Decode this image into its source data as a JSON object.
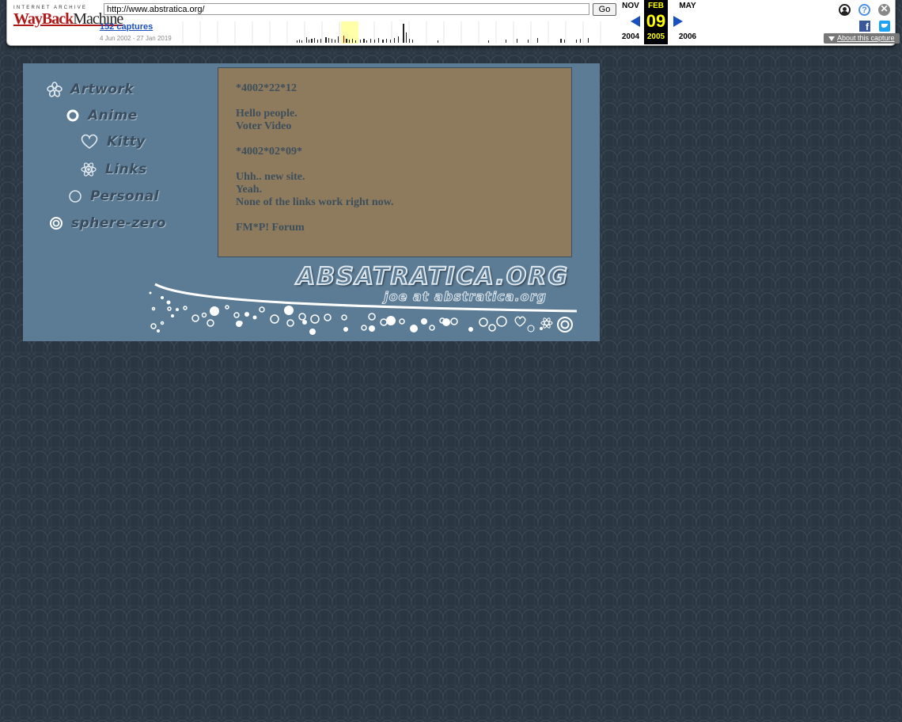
{
  "wayback": {
    "logo_top": "Internet Archive",
    "logo_main_a": "WayBack",
    "logo_main_b": "Machine",
    "url": "http://www.abstratica.org/",
    "go_label": "Go",
    "captures_label": "152 captures",
    "date_range": "4 Jun 2002 - 27 Jan 2019",
    "prev_month": "NOV",
    "prev_year": "2004",
    "current_month": "FEB",
    "current_day": "09",
    "current_year": "2005",
    "next_month": "MAY",
    "next_year": "2006",
    "help_glyph": "?",
    "close_glyph": "✕",
    "facebook_glyph": "f",
    "about_label": "About this capture"
  },
  "nav": {
    "items": [
      {
        "label": "Artwork",
        "icon": "flower-icon"
      },
      {
        "label": "Anime",
        "icon": "ring-icon"
      },
      {
        "label": "Kitty",
        "icon": "heart-icon"
      },
      {
        "label": "Links",
        "icon": "atom-icon"
      },
      {
        "label": "Personal",
        "icon": "circle-icon"
      },
      {
        "label": "sphere-zero",
        "icon": "target-icon"
      }
    ]
  },
  "news": {
    "date1": "*4002*22*12",
    "line1": "Hello people.",
    "link1": "Voter Video",
    "date2": "*4002*02*09*",
    "line2": "Uhh.. new site.",
    "line3": "Yeah.",
    "line4": "None of the links work right now.",
    "link2": "FM*P! Forum"
  },
  "brand": {
    "title": "ABSATRATICA.ORG",
    "email": "joe at abstratica.org"
  },
  "colors": {
    "page_bg": "#2a3642",
    "panel_bg": "#5c7b94",
    "news_bg": "#8e7a5c",
    "text": "#3e4f5c",
    "wayback_red": "#b01919",
    "wayback_blue": "#1a4fc2",
    "wayback_highlight": "#ffff00"
  }
}
